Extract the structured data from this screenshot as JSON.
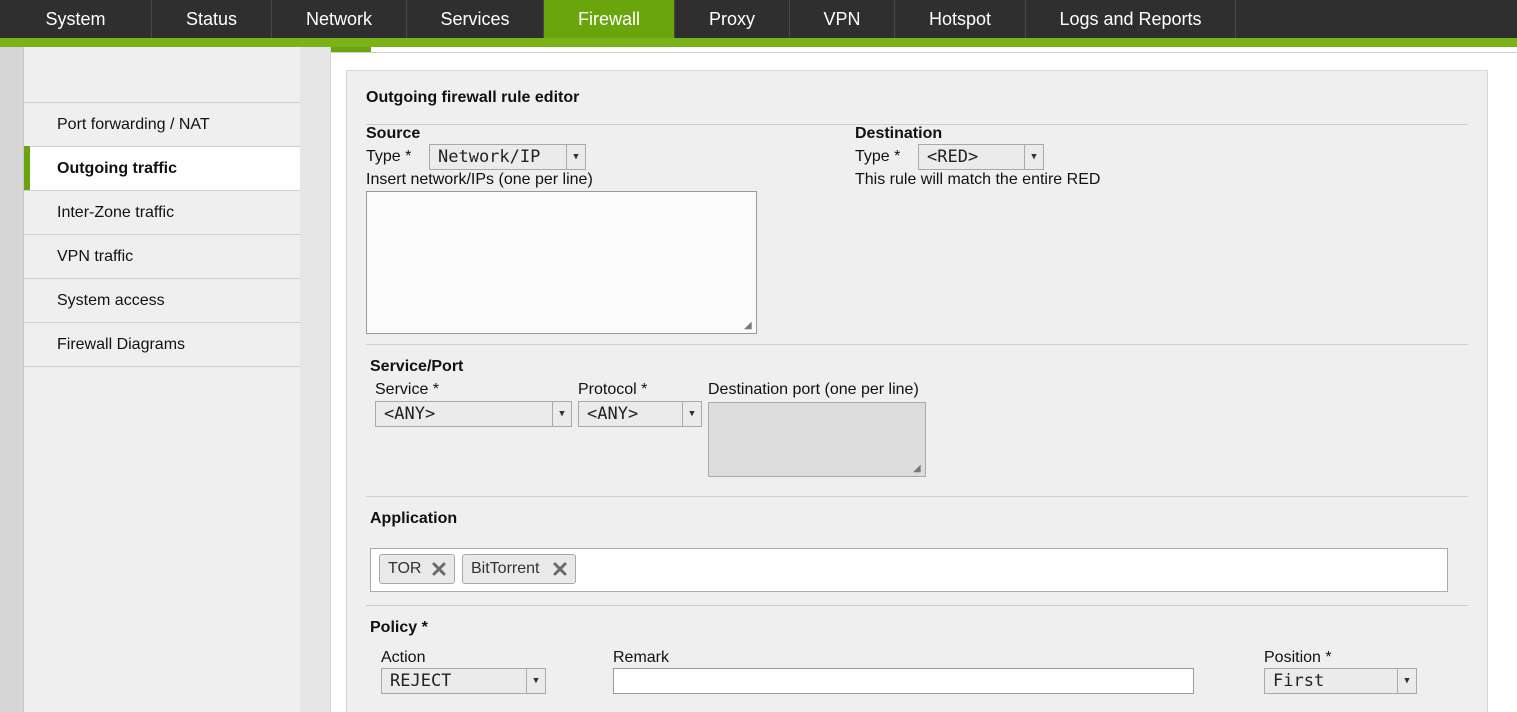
{
  "nav": {
    "tabs": [
      {
        "label": "System"
      },
      {
        "label": "Status"
      },
      {
        "label": "Network"
      },
      {
        "label": "Services"
      },
      {
        "label": "Firewall",
        "active": true
      },
      {
        "label": "Proxy"
      },
      {
        "label": "VPN"
      },
      {
        "label": "Hotspot"
      },
      {
        "label": "Logs and Reports"
      }
    ]
  },
  "sidebar": {
    "items": [
      {
        "label": "Port forwarding / NAT"
      },
      {
        "label": "Outgoing traffic",
        "active": true
      },
      {
        "label": "Inter-Zone traffic"
      },
      {
        "label": "VPN traffic"
      },
      {
        "label": "System access"
      },
      {
        "label": "Firewall Diagrams"
      }
    ]
  },
  "editor": {
    "title": "Outgoing firewall rule editor",
    "source": {
      "heading": "Source",
      "type_label": "Type *",
      "type_value": "Network/IP",
      "insert_label": "Insert network/IPs (one per line)",
      "textarea_value": ""
    },
    "destination": {
      "heading": "Destination",
      "type_label": "Type *",
      "type_value": "<RED>",
      "note": "This rule will match the entire RED"
    },
    "service_port": {
      "heading": "Service/Port",
      "service_label": "Service *",
      "service_value": "<ANY>",
      "protocol_label": "Protocol *",
      "protocol_value": "<ANY>",
      "dport_label": "Destination port (one per line)"
    },
    "application": {
      "heading": "Application",
      "tags": [
        "TOR",
        "BitTorrent"
      ]
    },
    "policy": {
      "heading": "Policy *",
      "action_label": "Action",
      "action_value": "REJECT",
      "remark_label": "Remark",
      "remark_value": "",
      "position_label": "Position *",
      "position_value": "First"
    }
  },
  "colors": {
    "nav_bg": "#2f2f2f",
    "accent_green": "#7ab317",
    "active_tab": "#6aa50e",
    "panel_bg": "#efefef"
  }
}
